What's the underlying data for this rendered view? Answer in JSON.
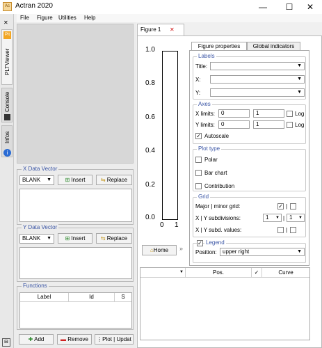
{
  "window": {
    "title": "Actran 2020",
    "minimize": "—",
    "maximize": "☐",
    "close": "✕"
  },
  "menu": [
    "File",
    "Figure",
    "Utilities",
    "Help"
  ],
  "side_tabs": {
    "pltviewer": "PLTViewer",
    "console": "Console",
    "infos": "Infos",
    "close": "✕",
    "pin": "⊟"
  },
  "x_vector": {
    "title": "X Data Vector",
    "combo": "BLANK",
    "insert": "Insert",
    "replace": "Replace"
  },
  "y_vector": {
    "title": "Y Data Vector",
    "combo": "BLANK",
    "insert": "Insert",
    "replace": "Replace"
  },
  "functions": {
    "title": "Functions",
    "columns": [
      "Label",
      "Id",
      "S"
    ],
    "add": "Add",
    "remove": "Remove",
    "plot": "Plot | Updat"
  },
  "figure": {
    "tab_label": "Figure 1",
    "tab_close": "✕",
    "y_ticks": [
      "1.0",
      "0.8",
      "0.6",
      "0.4",
      "0.2",
      "0.0"
    ],
    "x_ticks": [
      "0",
      "1"
    ],
    "home": "Home",
    "expand": "»"
  },
  "properties": {
    "tabs": [
      "Figure properties",
      "Global indicators"
    ],
    "labels": {
      "title": "Labels",
      "title_label": "Title:",
      "x_label": "X:",
      "y_label": "Y:",
      "title_value": "",
      "x_value": "",
      "y_value": ""
    },
    "axes": {
      "title": "Axes",
      "x_limits": "X limits:",
      "y_limits": "Y limits:",
      "xmin": "0",
      "xmax": "1",
      "ymin": "0",
      "ymax": "1",
      "log": "Log",
      "autoscale": "Autoscale",
      "autoscale_checked": true
    },
    "plot_type": {
      "title": "Plot type",
      "options": [
        "Polar",
        "Bar chart",
        "Contribution"
      ]
    },
    "grid": {
      "title": "Grid",
      "major_minor": "Major | minor grid:",
      "subdivisions": "X | Y subdivisions:",
      "subd_values": "X | Y subd. values:",
      "x_sub": "1",
      "y_sub": "1",
      "sep": "|"
    },
    "legend": {
      "title": "Legend",
      "position_label": "Position:",
      "position_value": "upper right"
    }
  },
  "curves": {
    "columns": [
      "",
      "Pos.",
      "",
      "Curve"
    ],
    "check": "✓"
  }
}
